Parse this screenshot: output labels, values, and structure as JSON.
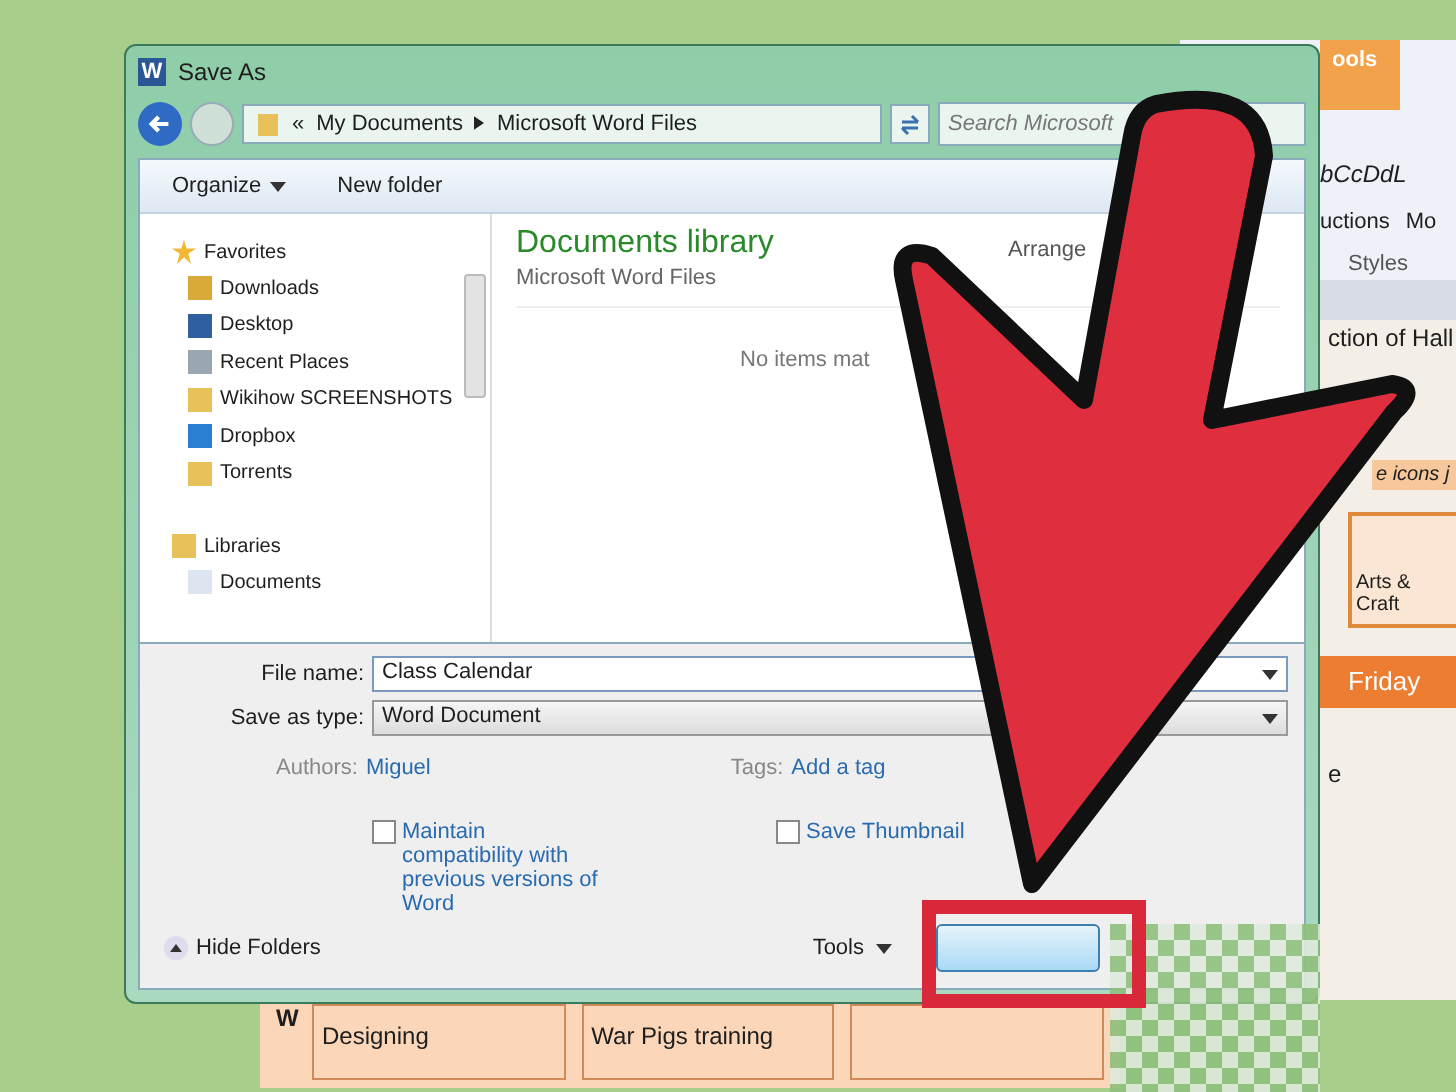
{
  "word_window": {
    "ribbon_tab": "ools",
    "style_preview": "bCcDdL",
    "ribbon_items": [
      "uctions",
      "Mo"
    ],
    "group_label": "Styles",
    "banner": "e icons j",
    "tile": "Arts & Craft",
    "day_header": "Friday",
    "cells": [
      "ction of Hall",
      "e"
    ],
    "row_label": "W",
    "row_cells": [
      "Designing",
      "War Pigs training",
      ""
    ]
  },
  "dialog": {
    "app_icon_letter": "W",
    "title": "Save As",
    "breadcrumb": [
      "«",
      "My Documents",
      "Microsoft Word Files"
    ],
    "search": {
      "placeholder": "Search Microsoft"
    },
    "toolbar": [
      {
        "label": "Organize",
        "kind": "menu"
      },
      {
        "label": "New folder",
        "kind": "button"
      }
    ],
    "sidebar": [
      {
        "label": "Favorites",
        "kind": "star",
        "children": [
          {
            "label": "Downloads",
            "kind": "downloads"
          },
          {
            "label": "Desktop",
            "kind": "desktop"
          },
          {
            "label": "Recent Places",
            "kind": "recent"
          },
          {
            "label": "Wikihow SCREENSHOTS",
            "kind": "folder"
          },
          {
            "label": "Dropbox",
            "kind": "dropbox"
          },
          {
            "label": "Torrents",
            "kind": "folder"
          }
        ]
      },
      {
        "label": "Libraries",
        "kind": "library",
        "children": [
          {
            "label": "Documents",
            "kind": "document"
          }
        ]
      }
    ],
    "content": {
      "title": "Documents library",
      "subtitle": "Microsoft Word Files",
      "arrange": "Arrange",
      "empty": "No items mat"
    },
    "file_name": {
      "label": "File name:",
      "value": "Class Calendar"
    },
    "save_type": {
      "label": "Save as type:",
      "value": "Word Document"
    },
    "authors": {
      "label": "Authors:",
      "value": "Miguel"
    },
    "tags": {
      "label": "Tags:",
      "value": "Add a tag"
    },
    "options": [
      {
        "label": "Maintain compatibility with previous versions of Word",
        "checked": false
      },
      {
        "label": "Save Thumbnail",
        "checked": false
      }
    ],
    "hide_folders": "Hide Folders",
    "tools": "Tools"
  }
}
